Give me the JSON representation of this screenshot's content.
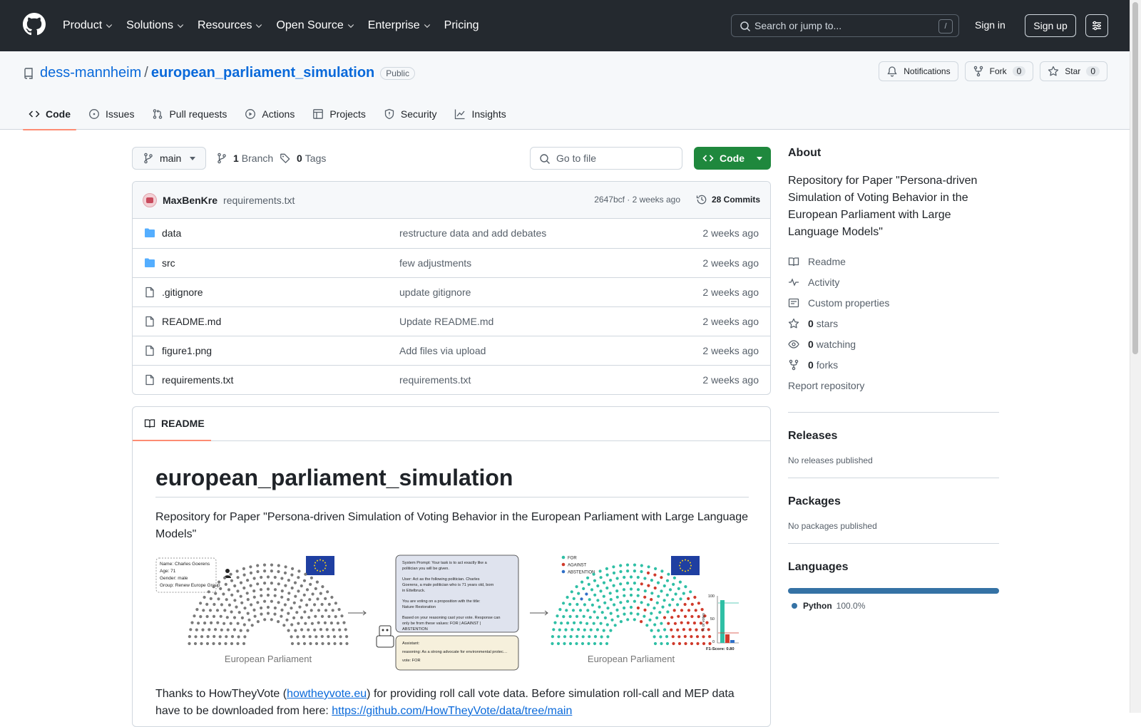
{
  "header": {
    "nav": [
      {
        "label": "Product",
        "dropdown": true
      },
      {
        "label": "Solutions",
        "dropdown": true
      },
      {
        "label": "Resources",
        "dropdown": true
      },
      {
        "label": "Open Source",
        "dropdown": true
      },
      {
        "label": "Enterprise",
        "dropdown": true
      },
      {
        "label": "Pricing",
        "dropdown": false
      }
    ],
    "search_placeholder": "Search or jump to...",
    "search_shortcut": "/",
    "sign_in": "Sign in",
    "sign_up": "Sign up"
  },
  "repo": {
    "owner": "dess-mannheim",
    "separator": "/",
    "name": "european_parliament_simulation",
    "visibility": "Public",
    "notifications_label": "Notifications",
    "fork_label": "Fork",
    "fork_count": "0",
    "star_label": "Star",
    "star_count": "0"
  },
  "tabs": [
    {
      "label": "Code",
      "icon": "code-icon",
      "active": true
    },
    {
      "label": "Issues",
      "icon": "issue-icon",
      "active": false
    },
    {
      "label": "Pull requests",
      "icon": "pull-request-icon",
      "active": false
    },
    {
      "label": "Actions",
      "icon": "play-icon",
      "active": false
    },
    {
      "label": "Projects",
      "icon": "table-icon",
      "active": false
    },
    {
      "label": "Security",
      "icon": "shield-icon",
      "active": false
    },
    {
      "label": "Insights",
      "icon": "graph-icon",
      "active": false
    }
  ],
  "toolbar": {
    "branch": "main",
    "branch_count": "1",
    "branch_label": "Branch",
    "tag_count": "0",
    "tag_label": "Tags",
    "goto_placeholder": "Go to file",
    "code_button": "Code"
  },
  "latest_commit": {
    "author": "MaxBenKre",
    "message": "requirements.txt",
    "hash_and_time": "2647bcf · 2 weeks ago",
    "commits_label": "28 Commits"
  },
  "files": [
    {
      "name": "data",
      "type": "folder",
      "message": "restructure data and add debates",
      "date": "2 weeks ago"
    },
    {
      "name": "src",
      "type": "folder",
      "message": "few adjustments",
      "date": "2 weeks ago"
    },
    {
      "name": ".gitignore",
      "type": "file",
      "message": "update gitignore",
      "date": "2 weeks ago"
    },
    {
      "name": "README.md",
      "type": "file",
      "message": "Update README.md",
      "date": "2 weeks ago"
    },
    {
      "name": "figure1.png",
      "type": "file",
      "message": "Add files via upload",
      "date": "2 weeks ago"
    },
    {
      "name": "requirements.txt",
      "type": "file",
      "message": "requirements.txt",
      "date": "2 weeks ago"
    }
  ],
  "readme": {
    "tab_label": "README",
    "title": "european_parliament_simulation",
    "intro": "Repository for Paper \"Persona-driven Simulation of Voting Behavior in the European Parliament with Large Language Models\"",
    "thanks_before": "Thanks to HowTheyVote (",
    "thanks_link": "howtheyvote.eu",
    "thanks_after": ") for providing roll call vote data. Before simulation roll-call and MEP data have to be downloaded from here: ",
    "data_link": "https://github.com/HowTheyVote/data/tree/main",
    "figure": {
      "persona_card": [
        "Name: Charles Goerens",
        "Age: 71",
        "Gender: male",
        "Group: Renew Europe Group"
      ],
      "left_caption": "European Parliament",
      "right_caption": "European Parliament",
      "prompt_lines": [
        "System Prompt: Your task is to act exactly like a politician you will be given.",
        "User: Act as the following politician. Charles Goerens, a male politician who is 71 years old, born in Ettelbruck.",
        "You are voting on a proposition with the title: Nature Restoration",
        "Based on your reasoning cast your vote. Response can only be from these values: FOR | AGAINST | ABSTENTION"
      ],
      "answer_lines": [
        "Assistant:",
        "reasoning: As a strong advocate for environmental protection, I believe in the importance of protecting ...",
        "vote: FOR"
      ],
      "legend": [
        "FOR",
        "AGAINST",
        "ABSTENTION"
      ],
      "mini_ylabel": "% of votes",
      "mini_ticks": [
        "100",
        "50",
        "0"
      ],
      "f1_label": "F1-Score: 0.80",
      "colors": {
        "for": "#2fbfa5",
        "against": "#d03a2b",
        "abstention": "#2f6fc7",
        "seat": "#7a7a7a",
        "eu_blue": "#1f3fa1",
        "eu_gold": "#f7d21a"
      }
    }
  },
  "about": {
    "heading": "About",
    "description": "Repository for Paper \"Persona-driven Simulation of Voting Behavior in the European Parliament with Large Language Models\"",
    "links": [
      {
        "icon": "book-icon",
        "bold": "",
        "label": "Readme"
      },
      {
        "icon": "pulse-icon",
        "bold": "",
        "label": "Activity"
      },
      {
        "icon": "note-icon",
        "bold": "",
        "label": "Custom properties"
      },
      {
        "icon": "star-icon",
        "bold": "0",
        "label": "stars"
      },
      {
        "icon": "eye-icon",
        "bold": "0",
        "label": "watching"
      },
      {
        "icon": "fork-icon",
        "bold": "0",
        "label": "forks"
      }
    ],
    "report": "Report repository"
  },
  "releases": {
    "heading": "Releases",
    "text": "No releases published"
  },
  "packages": {
    "heading": "Packages",
    "text": "No packages published"
  },
  "languages": {
    "heading": "Languages",
    "items": [
      {
        "name": "Python",
        "percent": "100.0%",
        "color": "#3572a5"
      }
    ]
  }
}
